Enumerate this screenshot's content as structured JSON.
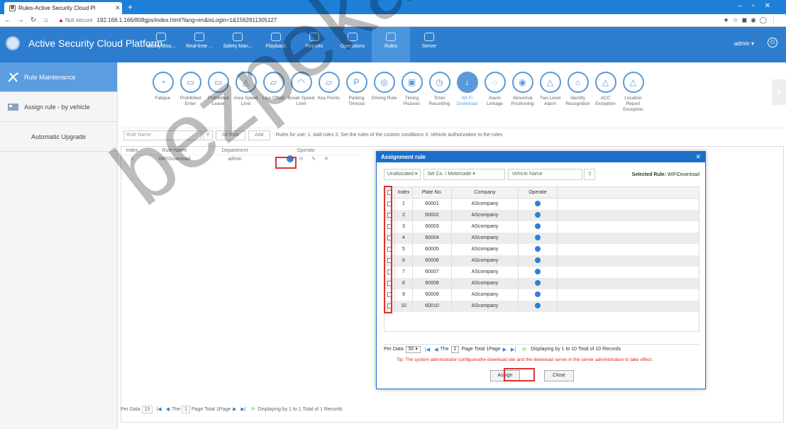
{
  "browser": {
    "tab_title": "Rules-Active Security Cloud Pl",
    "not_secure": "Not secure",
    "url": "192.168.1.166/808gps/index.html?lang=en&isLogin=1&1562811305127"
  },
  "app": {
    "title": "Active Security Cloud Platform",
    "nav": [
      "Safety Boa...",
      "Real-time ...",
      "Safety Man...",
      "Playback",
      "Reports",
      "Operations",
      "Rules",
      "Server"
    ],
    "active_nav": "Rules",
    "user": "admin ▾"
  },
  "sidebar": [
    {
      "label": "Rule Maintenance"
    },
    {
      "label": "Assign rule - by vehicle"
    },
    {
      "label": "Automatic Upgrade"
    }
  ],
  "rule_types": [
    "Fatigue",
    "Prohibited Enter",
    "Prohibited Leave",
    "Area Speed Limit",
    "Line Offset",
    "Break Speed Limit",
    "Key Points",
    "Parking Timeout",
    "Driving Rule",
    "Timing Pictures",
    "Timer Recording",
    "Wi-Fi Download",
    "Alarm Linkage",
    "Abnormal Positioning",
    "Two Level Alarm",
    "Identity Recognition",
    "ACC Exception",
    "Location Report Exception"
  ],
  "active_rule_type": "Wi-Fi Download",
  "toolbar": {
    "search_placeholder": "Rule Name",
    "all_rule": "All Rule",
    "add": "Add",
    "info": "Rules for use: 1. Add rules 2. Set the rules of the custom conditions 3. Vehicle authorization to the rules"
  },
  "rules_table": {
    "headers": [
      "Index",
      "Rule Name",
      "Department",
      "Operate"
    ],
    "rows": [
      [
        "1",
        "WiFiDownload",
        "admin"
      ]
    ]
  },
  "pager": {
    "per_data_label": "Per Data",
    "per_data": "15",
    "the_label": "The",
    "page": "1",
    "page_total": "Page  Total 1Page",
    "displaying": "Displaying by 1 to 1 Total of 1 Records"
  },
  "modal": {
    "title": "Assignment rule",
    "filter_unallocated": "Unallocated",
    "filter_company": "Sel Co. / Motorcade",
    "vehicle_placeholder": "Vehicle Name",
    "selected_rule_label": "Selected Rule:",
    "selected_rule": "WiFiDownload",
    "headers": [
      "Index",
      "Plate No.",
      "Company",
      "Operate"
    ],
    "rows": [
      [
        "1",
        "60001",
        "AScompany"
      ],
      [
        "2",
        "60002",
        "AScompany"
      ],
      [
        "3",
        "60003",
        "AScompany"
      ],
      [
        "4",
        "60004",
        "AScompany"
      ],
      [
        "5",
        "60005",
        "AScompany"
      ],
      [
        "6",
        "60006",
        "AScompany"
      ],
      [
        "7",
        "60007",
        "AScompany"
      ],
      [
        "8",
        "60008",
        "AScompany"
      ],
      [
        "9",
        "60009",
        "AScompany"
      ],
      [
        "10",
        "60010",
        "AScompany"
      ]
    ],
    "pager": {
      "per_data_label": "Per Data",
      "per_data": "50",
      "the_label": "The",
      "page": "1",
      "page_total": "Page  Total 1Page",
      "displaying": "Displaying by 1 to 10 Total of 10 Records"
    },
    "tip": "Tip: The system administrator configuresthe download site and the download server in the server administration to take effect.",
    "assign": "Assign",
    "close": "Close"
  },
  "watermark": "bezpeka-shop",
  "colors": {
    "header": "#2c7ccf",
    "modal_title": "#1b6fca",
    "highlight": "#d33333",
    "tip": "#dd2222"
  }
}
